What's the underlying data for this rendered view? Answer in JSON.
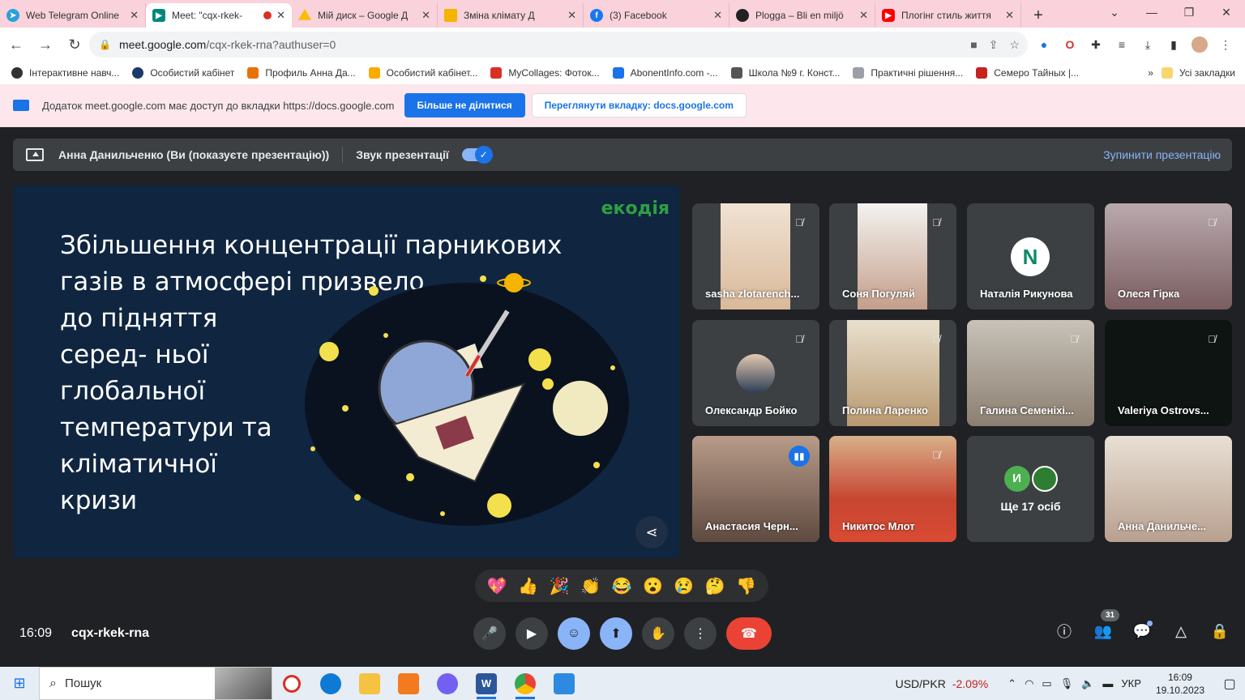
{
  "tabs": [
    {
      "title": "Web Telegram Online",
      "fav": "telegram-icon",
      "color": "#2aa1dc"
    },
    {
      "title": "Meet: \"cqx-rkek-",
      "fav": "meet-icon",
      "color": "#00897b",
      "active": true
    },
    {
      "title": "Мій диск – Google Д",
      "fav": "drive-icon",
      "color": "#fbbc04"
    },
    {
      "title": "Зміна клімату Д",
      "fav": "slides-icon",
      "color": "#f4b400"
    },
    {
      "title": "(3) Facebook",
      "fav": "facebook-icon",
      "color": "#1877f2"
    },
    {
      "title": "Plogga – Bli en miljö",
      "fav": "plogga-icon",
      "color": "#222"
    },
    {
      "title": "Плогінг стиль життя",
      "fav": "youtube-icon",
      "color": "#ff0000"
    }
  ],
  "address": {
    "host": "meet.google.com",
    "path": "/cqx-rkek-rna?authuser=0"
  },
  "bookmarks": [
    {
      "label": "Інтерактивне навч...",
      "color": "#333"
    },
    {
      "label": "Особистий кабінет",
      "color": "#1a3a6b"
    },
    {
      "label": "Профиль Анна Да...",
      "color": "#e8710a"
    },
    {
      "label": "Особистий кабінет...",
      "color": "#f9ab00"
    },
    {
      "label": "MyCollages: Фоток...",
      "color": "#d93025"
    },
    {
      "label": "AbonentInfo.com -...",
      "color": "#1a73e8"
    },
    {
      "label": "Школа №9 г. Конст...",
      "color": "#555"
    },
    {
      "label": "Практичні рішення...",
      "color": "#9aa0a6"
    },
    {
      "label": "Семеро Тайных |...",
      "color": "#c5221f"
    }
  ],
  "bookmarks_more": "»",
  "all_bookmarks": "Усі закладки",
  "share_notice": {
    "text": "Додаток meet.google.com має доступ до вкладки https://docs.google.com",
    "stop_label": "Більше не ділитися",
    "view_label": "Переглянути вкладку: docs.google.com"
  },
  "presenting": {
    "text": "Анна Данильченко (Ви (показуєте презентацію))",
    "audio_label": "Звук презентації",
    "stop_label": "Зупинити презентацію"
  },
  "slide": {
    "logo": "екодія",
    "lines": [
      "Збільшення концентрації парникових",
      "газів  в атмосфері призвело",
      "до підняття",
      "серед-  ньої",
      "глобальної",
      "температури та",
      "кліматичної",
      "кризи"
    ]
  },
  "participants": [
    {
      "name": "sasha zlotarench...",
      "muted": true,
      "bg": "#e9d8c8"
    },
    {
      "name": "Соня Погуляй",
      "muted": true,
      "bg": "#e7e4e2"
    },
    {
      "name": "Наталія Рикунова",
      "muted": false,
      "avatar": "N"
    },
    {
      "name": "Олеся Гірка",
      "muted": true,
      "bg": "#c7b6b6"
    },
    {
      "name": "Олександр Бойко",
      "muted": true,
      "avatar_photo": true
    },
    {
      "name": "Полина Ларенко",
      "muted": true,
      "bg": "#c9b89a"
    },
    {
      "name": "Галина Семеніхі...",
      "muted": true,
      "bg": "#b7b0a6"
    },
    {
      "name": "Valeriya Ostrovs...",
      "muted": true,
      "bg": "#0d1412"
    },
    {
      "name": "Анастасия Черн...",
      "muted": false,
      "speaking": true,
      "bg": "#8d7566"
    },
    {
      "name": "Никитос Млот",
      "muted": true,
      "bg": "#c94b32"
    },
    {
      "more": true,
      "label": "Ще 17 осіб",
      "initial": "И"
    },
    {
      "name": "Анна Данильче...",
      "muted": false,
      "bg": "#d8d2c6"
    }
  ],
  "reactions": [
    "💖",
    "👍",
    "🎉",
    "👏",
    "😂",
    "😮",
    "😢",
    "🤔",
    "👎"
  ],
  "meeting": {
    "time": "16:09",
    "code": "cqx-rkek-rna"
  },
  "people_count": "31",
  "taskbar": {
    "search_placeholder": "Пошук",
    "stock_label": "USD/PKR",
    "stock_change": "-2.09%",
    "lang": "УКР",
    "time": "16:09",
    "date": "19.10.2023"
  }
}
